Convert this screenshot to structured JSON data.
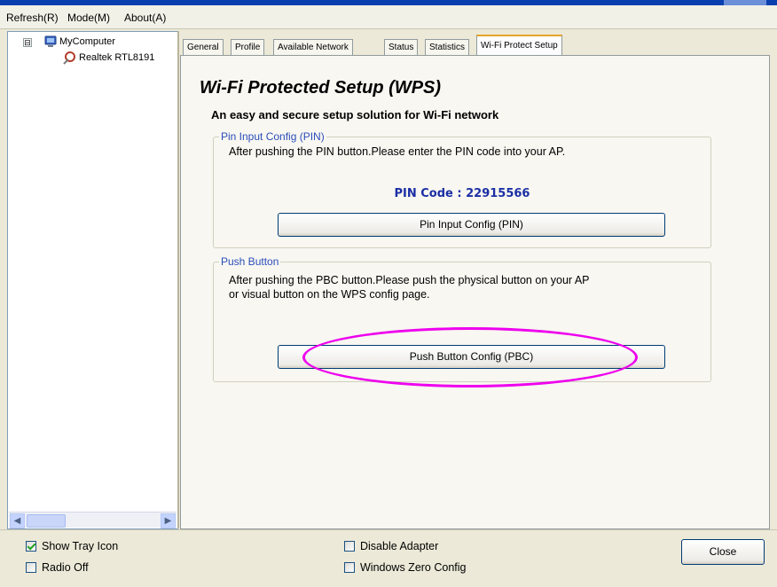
{
  "menu": [
    "Refresh(R)",
    "Mode(M)",
    "About(A)"
  ],
  "tree": {
    "expander": "⊟",
    "root_label": "MyComputer",
    "child_label": "Realtek RTL8191"
  },
  "tabs": [
    "General",
    "Profile",
    "Available Network",
    "Status",
    "Statistics",
    "Wi-Fi Protect Setup"
  ],
  "active_tab": "Wi-Fi Protect Setup",
  "main": {
    "title": "Wi-Fi Protected Setup (WPS)",
    "subtitle": "An easy and secure setup solution for Wi-Fi network",
    "pin_group": {
      "legend": "Pin Input Config (PIN)",
      "description": "After pushing the PIN button.Please enter the PIN code into your AP.",
      "pin_code_text": "PIN Code :  22915566",
      "button_label": "Pin Input Config (PIN)"
    },
    "push_group": {
      "legend": "Push Button",
      "description_line1": "After pushing the PBC button.Please push the physical button on your AP",
      "description_line2": "or visual button on the WPS config page.",
      "button_label": "Push Button Config (PBC)"
    }
  },
  "bottom": {
    "show_tray_icon": {
      "label": "Show Tray Icon",
      "checked": true
    },
    "radio_off": {
      "label": "Radio Off",
      "checked": false
    },
    "disable_adapter": {
      "label": "Disable Adapter",
      "checked": false
    },
    "windows_zero_config": {
      "label": "Windows Zero Config",
      "checked": false
    },
    "close_label": "Close"
  },
  "colors": {
    "highlight": "#ee00ee",
    "pin_code": "#1b2fa5",
    "legend": "#2b4dbb",
    "active_tab_accent": "#e6a329"
  },
  "icons": {
    "computer": "computer-icon",
    "adapter": "network-adapter-icon",
    "scroll_left": "◀",
    "scroll_right": "▶"
  }
}
